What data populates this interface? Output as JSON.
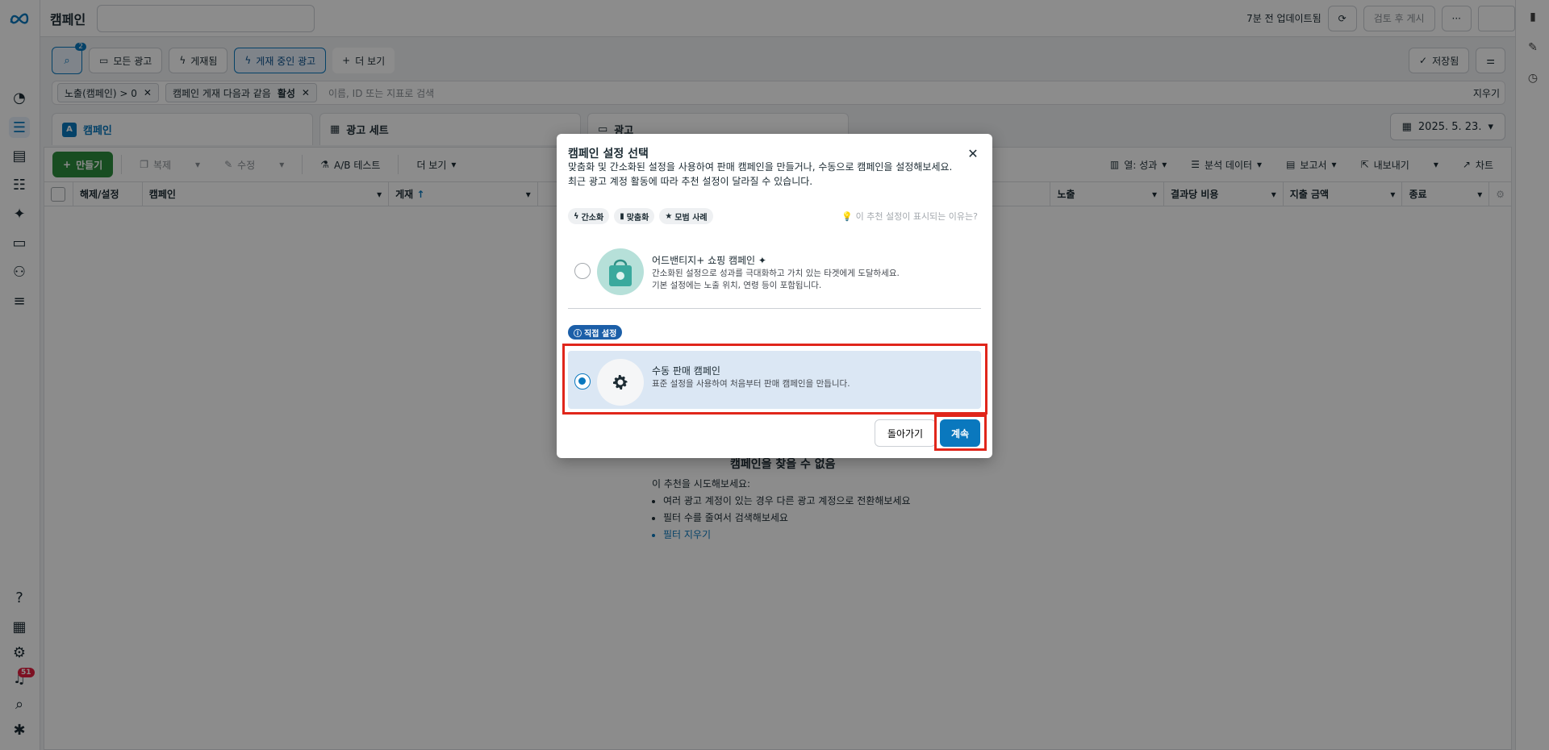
{
  "topbar": {
    "title": "캠페인",
    "updated": "7분 전 업데이트됨",
    "review_publish": "검토 후 게시",
    "more": "···"
  },
  "filters": {
    "search_count": "2",
    "all_ads": "모든 광고",
    "published": "게재됨",
    "active_ads": "게재 중인 광고",
    "see_more": "더 보기",
    "saved": "저장됨"
  },
  "chips": {
    "chip1": "노출(캠페인) > 0",
    "chip2_prefix": "캠페인 게재 다음과 같음",
    "chip2_value": "활성",
    "search_placeholder": "이름, ID 또는 지표로 검색",
    "clear": "지우기"
  },
  "tabs": {
    "campaign": "캠페인",
    "adset": "광고 세트",
    "ad": "광고",
    "date": "2025. 5. 23."
  },
  "toolbar": {
    "create": "만들기",
    "duplicate": "복제",
    "edit": "수정",
    "ab_test": "A/B 테스트",
    "more": "더 보기",
    "columns": "열: 성과",
    "breakdown": "분석 데이터",
    "reports": "보고서",
    "export": "내보내기",
    "charts": "차트"
  },
  "table": {
    "headers": [
      "해제/설정",
      "캠페인",
      "게재",
      "노출",
      "결과당 비용",
      "지출 금액",
      "종료"
    ]
  },
  "empty_state": {
    "title": "캠페인을 찾을 수 없음",
    "intro": "이 추천을 시도해보세요:",
    "tips": [
      "여러 광고 계정이 있는 경우 다른 광고 계정으로 전환해보세요",
      "필터 수를 줄여서 검색해보세요"
    ],
    "clear_link": "필터 지우기"
  },
  "rail": {
    "notification_count": "51"
  },
  "modal": {
    "title": "캠페인 설정 선택",
    "desc_line1": "맞춤화 및 간소화된 설정을 사용하여 판매 캠페인을 만들거나, 수동으로 캠페인을 설정해보세요.",
    "desc_line2": "최근 광고 계정 활동에 따라 추천 설정이 달라질 수 있습니다.",
    "tags": [
      "간소화",
      "맞춤화",
      "모범 사례"
    ],
    "why": "이 추천 설정이 표시되는 이유는?",
    "advantage": {
      "title": "어드밴티지+ 쇼핑 캠페인",
      "desc1": "간소화된 설정으로 성과를 극대화하고 가치 있는 타겟에게 도달하세요.",
      "desc2": "기본 설정에는 노출 위치, 연령 등이 포함됩니다.",
      "selected": false
    },
    "manual_tag": "직접 설정",
    "manual": {
      "title": "수동 판매 캠페인",
      "desc": "표준 설정을 사용하여 처음부터 판매 캠페인을 만듭니다.",
      "selected": true
    },
    "back": "돌아가기",
    "continue": "계속"
  },
  "colors": {
    "accent": "#0a78be",
    "create_green": "#2d8c3c",
    "highlight_red": "#e0261b",
    "notification_red": "#e41e3f"
  }
}
